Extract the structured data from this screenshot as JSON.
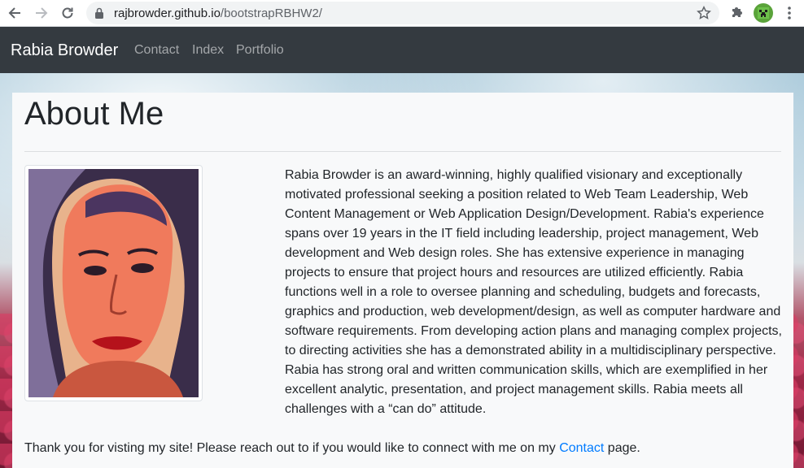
{
  "browser": {
    "url_host": "rajbrowder.github.io",
    "url_path": "/bootstrapRBHW2/"
  },
  "navbar": {
    "brand": "Rabia Browder",
    "links": [
      "Contact",
      "Index",
      "Portfolio"
    ]
  },
  "main": {
    "title": "About Me",
    "bio": "Rabia Browder is an award-winning, highly qualified visionary and exceptionally motivated professional seeking a position related to Web Team Leadership, Web Content Management or Web Application Design/Development. Rabia's experience spans over 19 years in the IT field including leadership, project management, Web development and Web design roles. She has extensive experience in managing projects to ensure that project hours and resources are utilized efficiently. Rabia functions well in a role to oversee planning and scheduling, budgets and forecasts, graphics and production, web development/design, as well as computer hardware and software requirements. From developing action plans and managing complex projects, to directing activities she has a demonstrated ability in a multidisciplinary perspective. Rabia has strong oral and written communication skills, which are exemplified in her excellent analytic, presentation, and project management skills. Rabia meets all challenges with a “can do” attitude.",
    "thanks_before": "Thank you for visting my site! Please reach out to if you would like to connect with me on my ",
    "thanks_link": "Contact",
    "thanks_after": " page."
  },
  "icons": {
    "back": "back-arrow-icon",
    "forward": "forward-arrow-icon",
    "reload": "reload-icon",
    "lock": "lock-icon",
    "star": "bookmark-star-icon",
    "extensions": "puzzle-icon",
    "profile": "profile-avatar-icon",
    "menu": "kebab-menu-icon"
  },
  "colors": {
    "navbar_bg": "#343a40",
    "link": "#007bff",
    "card_bg": "#f8f9fa"
  }
}
